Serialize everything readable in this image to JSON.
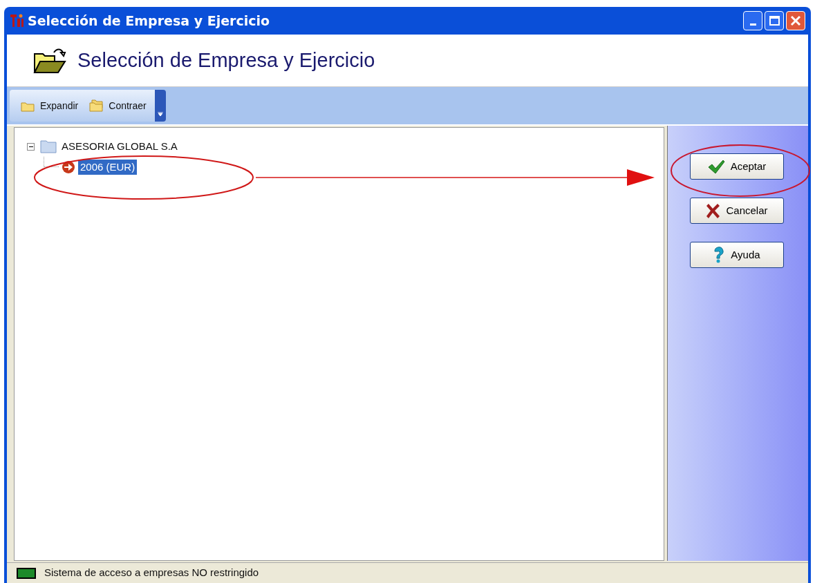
{
  "window": {
    "title": "Selección de Empresa y Ejercicio"
  },
  "header": {
    "title": "Selección de Empresa y Ejercicio"
  },
  "toolbar": [
    {
      "kind": "expand",
      "label": "Expandir"
    },
    {
      "kind": "collapse",
      "label": "Contraer"
    }
  ],
  "tree": [
    {
      "label": "ASESORIA GLOBAL S.A",
      "kind": "company",
      "expanded": true,
      "selected": false,
      "children": [
        {
          "label": "2006 (EUR)",
          "kind": "year",
          "selected": true
        }
      ]
    }
  ],
  "buttons": [
    {
      "kind": "accept",
      "label": "Aceptar"
    },
    {
      "kind": "cancel",
      "label": "Cancelar"
    },
    {
      "kind": "help",
      "label": "Ayuda"
    }
  ],
  "status_bar": {
    "text": "Sistema de acceso a empresas NO restringido"
  }
}
